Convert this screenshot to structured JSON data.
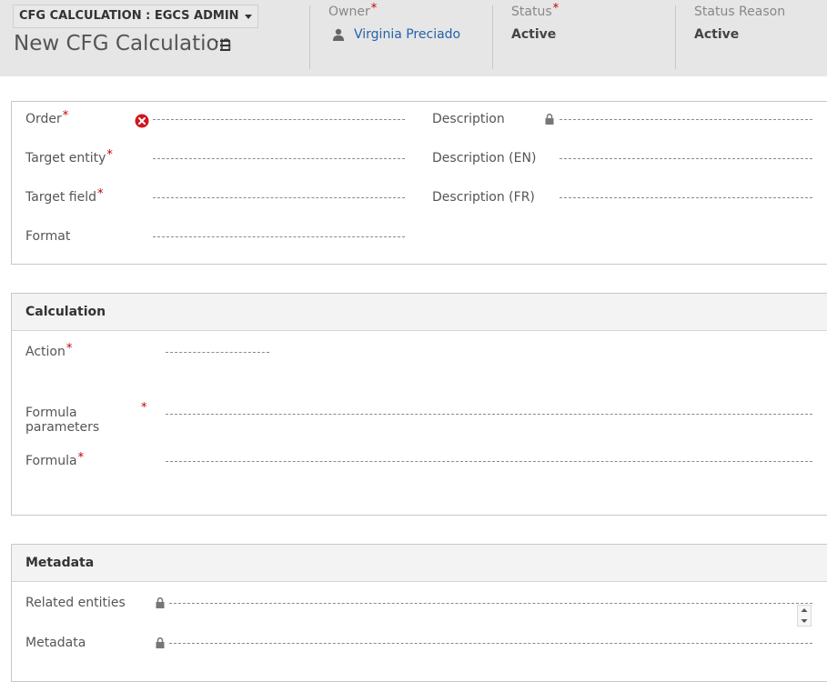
{
  "header": {
    "form_selector": "CFG CALCULATION : EGCS ADMIN",
    "record_title": "New CFG Calculation",
    "owner": {
      "label": "Owner",
      "value": "Virginia Preciado",
      "required": "*"
    },
    "status": {
      "label": "Status",
      "value": "Active",
      "required": "*"
    },
    "status_reason": {
      "label": "Status Reason",
      "value": "Active"
    }
  },
  "general": {
    "order_label": "Order",
    "target_entity_label": "Target entity",
    "target_field_label": "Target field",
    "format_label": "Format",
    "description_label": "Description",
    "description_en_label": "Description (EN)",
    "description_fr_label": "Description (FR)",
    "required": "*"
  },
  "calculation": {
    "title": "Calculation",
    "action_label": "Action",
    "formula_parameters_label_1": "Formula",
    "formula_parameters_label_2": "parameters",
    "formula_label": "Formula",
    "required": "*"
  },
  "metadata": {
    "title": "Metadata",
    "related_entities_label": "Related entities",
    "metadata_label": "Metadata"
  },
  "colors": {
    "header_bg": "#e6e6e6",
    "required": "#c00000",
    "link": "#2263a8",
    "error": "#d0161e"
  },
  "icons": [
    "chevron-down-icon",
    "nav-menu-icon",
    "person-icon",
    "error-icon",
    "lock-icon",
    "spinner-up-icon",
    "spinner-down-icon"
  ]
}
